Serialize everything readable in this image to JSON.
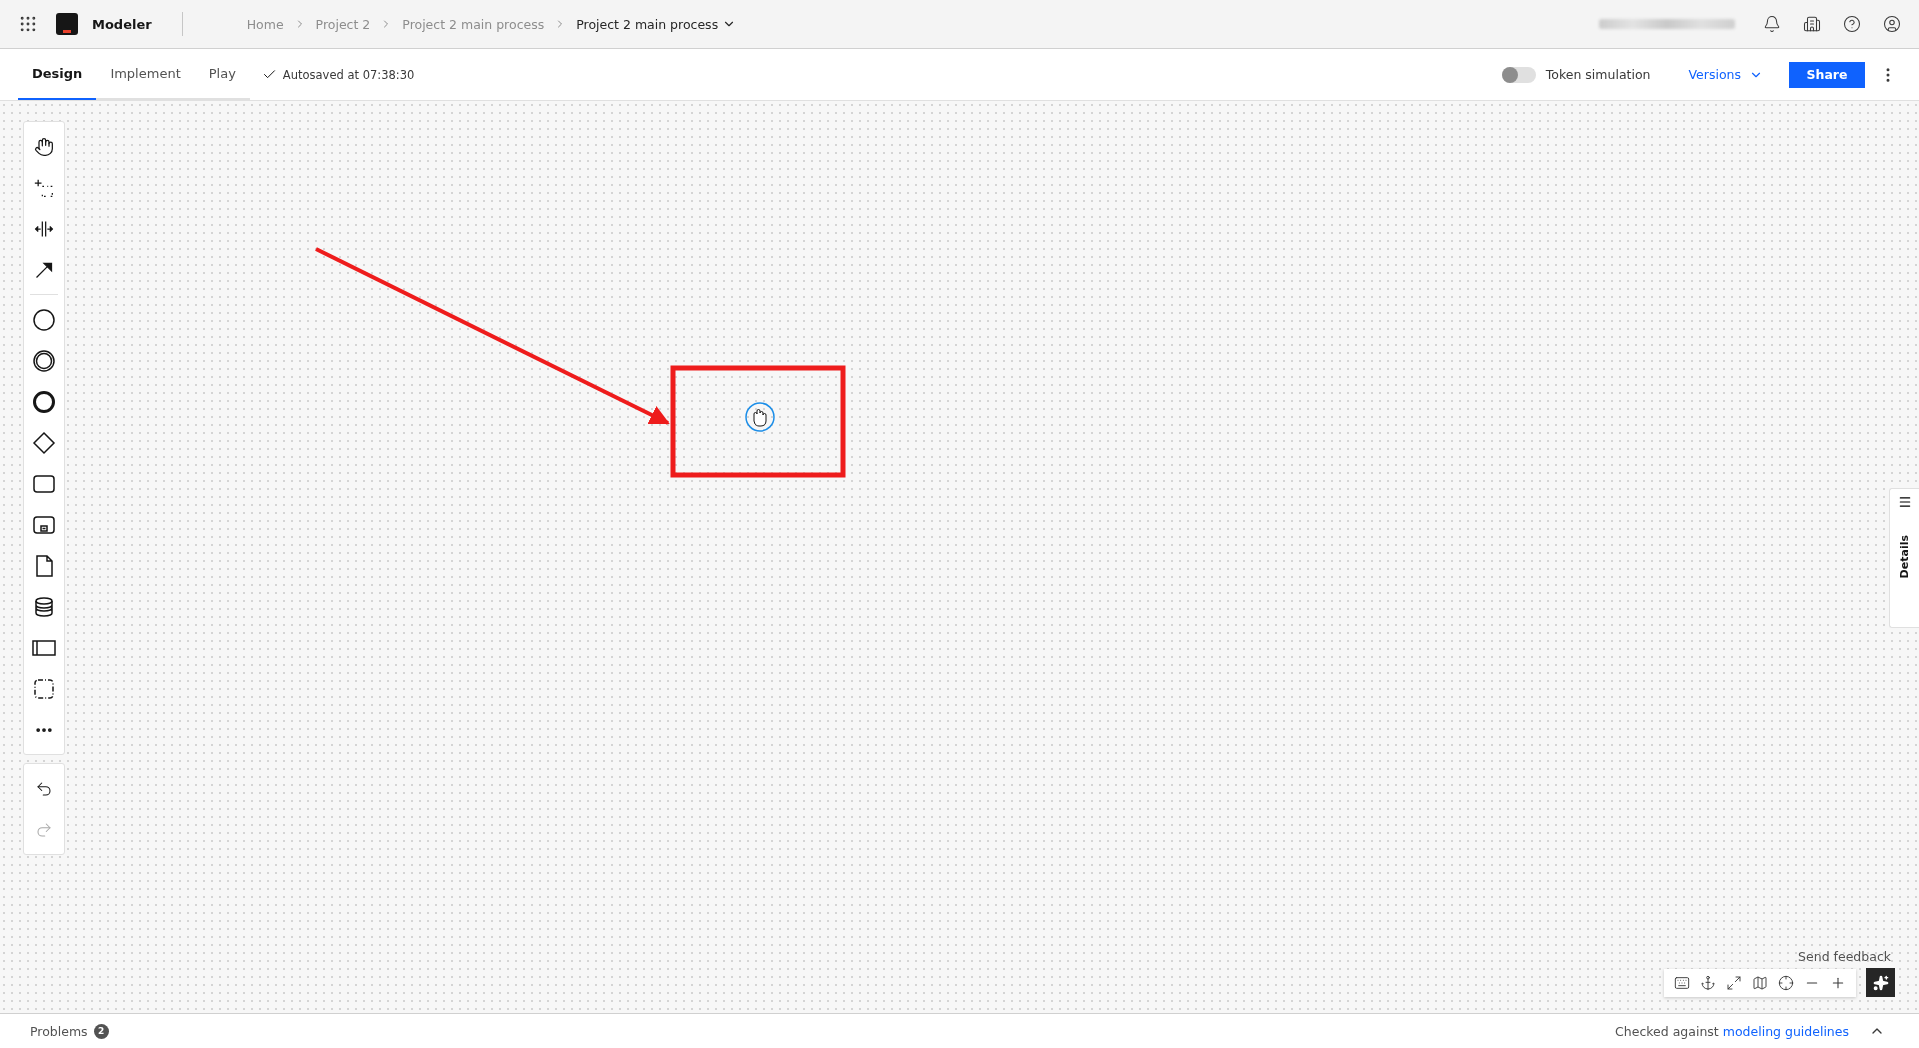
{
  "header": {
    "app_name": "Modeler",
    "breadcrumbs": [
      {
        "label": "Home",
        "current": false
      },
      {
        "label": "Project 2",
        "current": false
      },
      {
        "label": "Project 2 main process",
        "current": false
      },
      {
        "label": "Project 2 main process",
        "current": true
      }
    ]
  },
  "tabs": [
    {
      "label": "Design",
      "selected": true
    },
    {
      "label": "Implement",
      "selected": false
    },
    {
      "label": "Play",
      "selected": false
    }
  ],
  "autosave": "Autosaved at 07:38:30",
  "token_simulation": {
    "label": "Token simulation",
    "on": false
  },
  "versions": "Versions",
  "share": "Share",
  "details_tab": "Details",
  "send_feedback": "Send feedback",
  "problems": {
    "label": "Problems",
    "count": "2"
  },
  "guidelines": {
    "prefix": "Checked against",
    "link": "modeling guidelines"
  }
}
